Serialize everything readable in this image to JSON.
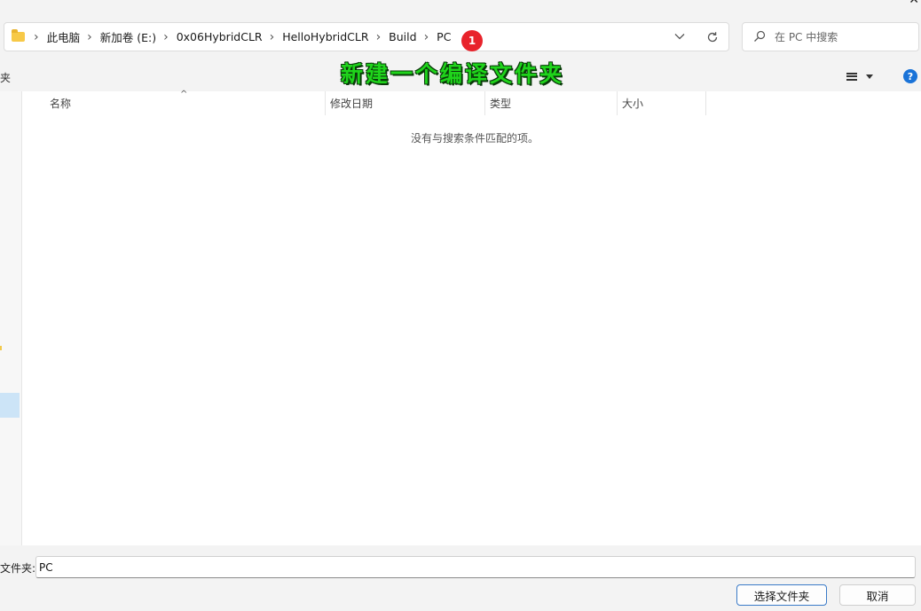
{
  "window": {
    "close_glyph": "✕"
  },
  "address_bar": {
    "breadcrumbs": [
      "此电脑",
      "新加卷 (E:)",
      "0x06HybridCLR",
      "HelloHybridCLR",
      "Build",
      "PC"
    ],
    "separator": "›",
    "folder_icon": "folder-icon",
    "dropdown_icon": "chevron-down-icon",
    "refresh_icon": "refresh-icon"
  },
  "annotation": {
    "badge_number": "1",
    "badge_color": "#e8232b",
    "caption": "新建一个编译文件夹",
    "caption_color": "#1fd41b"
  },
  "search": {
    "placeholder": "在 PC 中搜索",
    "value": "",
    "icon": "search-icon"
  },
  "toolbar": {
    "left_cut_label": "夹",
    "view_icon": "view-list-icon",
    "help_label": "?"
  },
  "file_list": {
    "columns": [
      "名称",
      "修改日期",
      "类型",
      "大小"
    ],
    "sort_indicator": "^",
    "empty_message": "没有与搜索条件匹配的项。",
    "rows": []
  },
  "footer": {
    "folder_label": "文件夹:",
    "folder_value": "PC",
    "select_button": "选择文件夹",
    "cancel_button": "取消",
    "accent": "#3b7bc8"
  }
}
